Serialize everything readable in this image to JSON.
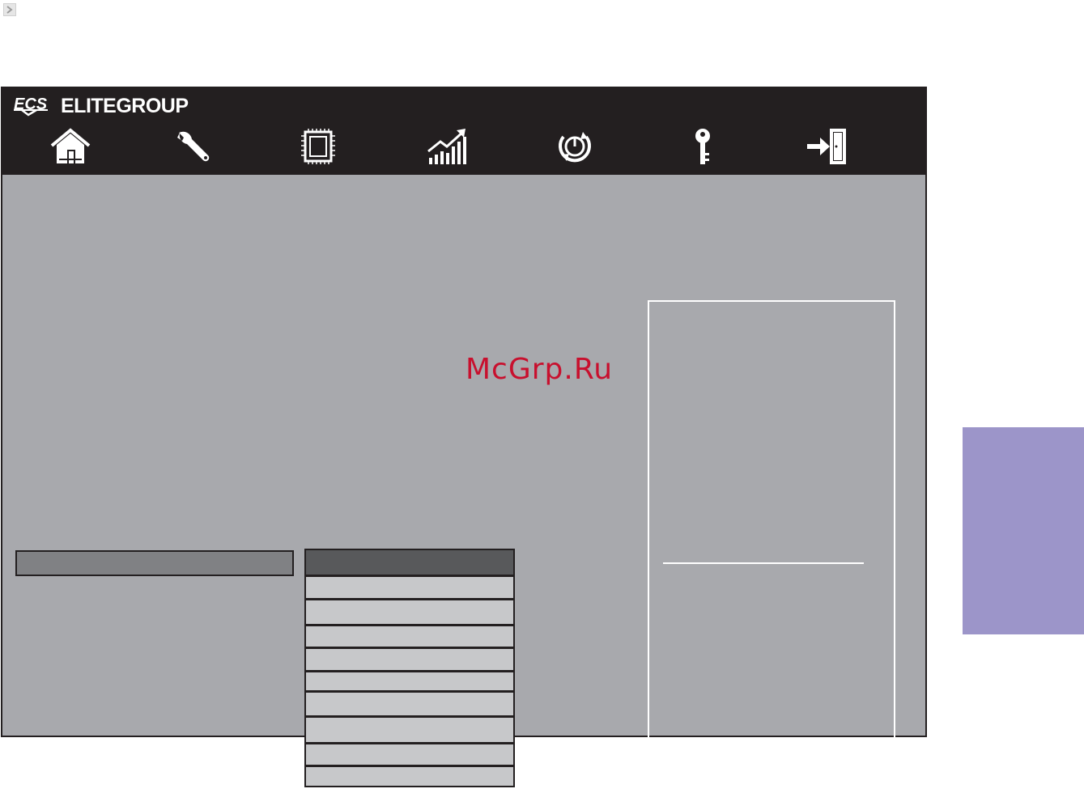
{
  "header": {
    "brand_logo": "ECS",
    "brand_name": "ELITEGROUP",
    "nav_icons": [
      "home-icon",
      "wrench-icon",
      "chip-icon",
      "chart-up-icon",
      "power-icon",
      "key-icon",
      "exit-icon"
    ]
  },
  "watermark": "McGrp.Ru",
  "colors": {
    "header_bg": "#231f20",
    "body_bg": "#a8a9ad",
    "left_bar": "#808184",
    "popup_head": "#58595b",
    "popup_row": "#c7c8ca",
    "side_tab": "#9c95c9",
    "watermark": "#c8102e"
  }
}
